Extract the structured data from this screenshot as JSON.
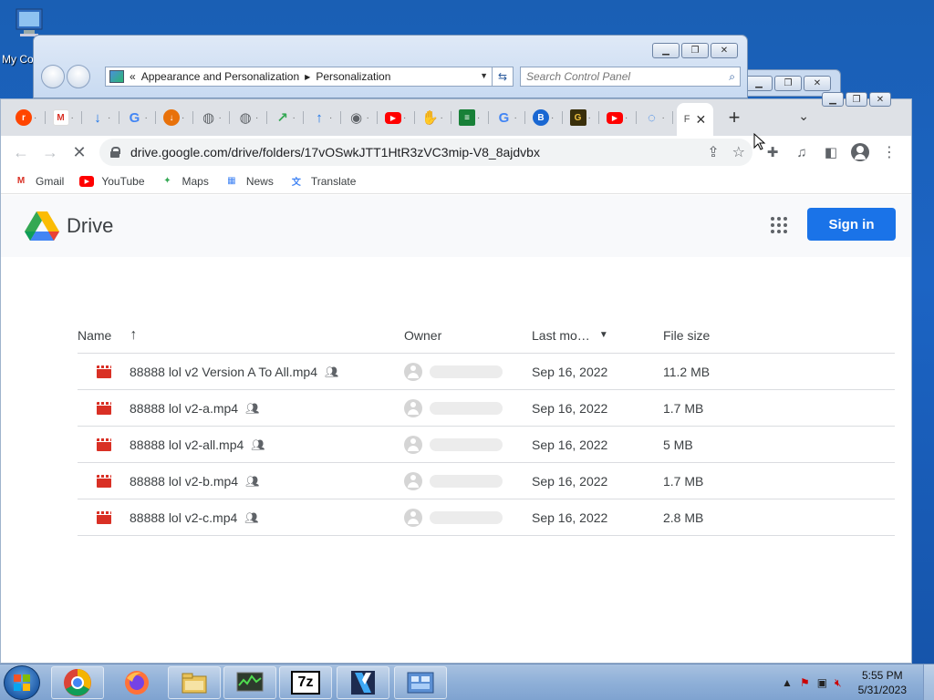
{
  "desktop": {
    "icon_label": "My Co"
  },
  "control_panel": {
    "breadcrumb_root": "Appearance and Personalization",
    "breadcrumb_leaf": "Personalization",
    "search_placeholder": "Search Control Panel"
  },
  "browser": {
    "tabs": [
      {
        "icon": "reddit-icon",
        "color": "#ff4500",
        "glyph": "r"
      },
      {
        "icon": "gmail-icon",
        "color": "#d93025",
        "glyph": "M"
      },
      {
        "icon": "download-icon",
        "color": "#1a73e8",
        "glyph": "↓"
      },
      {
        "icon": "google-icon",
        "color": "#4285f4",
        "glyph": "G"
      },
      {
        "icon": "download-orange-icon",
        "color": "#e8710a",
        "glyph": "↓"
      },
      {
        "icon": "globe-icon",
        "color": "#5f6368",
        "glyph": "◍"
      },
      {
        "icon": "globe-icon",
        "color": "#5f6368",
        "glyph": "◍"
      },
      {
        "icon": "share-icon",
        "color": "#34a853",
        "glyph": "↗"
      },
      {
        "icon": "upload-icon",
        "color": "#1a73e8",
        "glyph": "↑"
      },
      {
        "icon": "chrome-icon",
        "color": "#5f6368",
        "glyph": "◉"
      },
      {
        "icon": "youtube-icon",
        "color": "#ff0000",
        "glyph": "▶"
      },
      {
        "icon": "handshake-icon",
        "color": "#444",
        "glyph": "✋"
      },
      {
        "icon": "spreadsheet-icon",
        "color": "#188038",
        "glyph": "≡"
      },
      {
        "icon": "google-icon",
        "color": "#4285f4",
        "glyph": "G"
      },
      {
        "icon": "shield-icon",
        "color": "#1967d2",
        "glyph": "B"
      },
      {
        "icon": "g-dark-icon",
        "color": "#3a2f0b",
        "glyph": "G"
      },
      {
        "icon": "youtube-icon",
        "color": "#ff0000",
        "glyph": "▶"
      },
      {
        "icon": "loading-icon",
        "color": "#1a73e8",
        "glyph": "◌"
      }
    ],
    "active_tab_label": "F",
    "url": "drive.google.com/drive/folders/17vOSwkJTT1HtR3zVC3mip-V8_8ajdvbx",
    "bookmarks": [
      {
        "label": "Gmail",
        "icon": "gmail-icon",
        "color": "#d93025",
        "glyph": "M"
      },
      {
        "label": "YouTube",
        "icon": "youtube-icon",
        "color": "#ff0000",
        "glyph": "▶"
      },
      {
        "label": "Maps",
        "icon": "maps-icon",
        "color": "#34a853",
        "glyph": "✦"
      },
      {
        "label": "News",
        "icon": "news-icon",
        "color": "#4285f4",
        "glyph": "▦"
      },
      {
        "label": "Translate",
        "icon": "translate-icon",
        "color": "#4285f4",
        "glyph": "文"
      }
    ]
  },
  "drive": {
    "title": "Drive",
    "sign_in": "Sign in",
    "columns": {
      "name": "Name",
      "owner": "Owner",
      "modified": "Last mo…",
      "size": "File size"
    },
    "files": [
      {
        "name": "88888 lol v2 Version A To All.mp4",
        "modified": "Sep 16, 2022",
        "size": "11.2 MB"
      },
      {
        "name": "88888 lol v2-a.mp4",
        "modified": "Sep 16, 2022",
        "size": "1.7 MB"
      },
      {
        "name": "88888 lol v2-all.mp4",
        "modified": "Sep 16, 2022",
        "size": "5 MB"
      },
      {
        "name": "88888 lol v2-b.mp4",
        "modified": "Sep 16, 2022",
        "size": "1.7 MB"
      },
      {
        "name": "88888 lol v2-c.mp4",
        "modified": "Sep 16, 2022",
        "size": "2.8 MB"
      }
    ]
  },
  "taskbar": {
    "time": "5:55 PM",
    "date": "5/31/2023",
    "apps": [
      "chrome-icon",
      "firefox-icon",
      "file-explorer-icon",
      "task-manager-icon",
      "7zip-icon",
      "video-editor-icon",
      "control-panel-icon"
    ],
    "seven_zip_label": "7z"
  }
}
